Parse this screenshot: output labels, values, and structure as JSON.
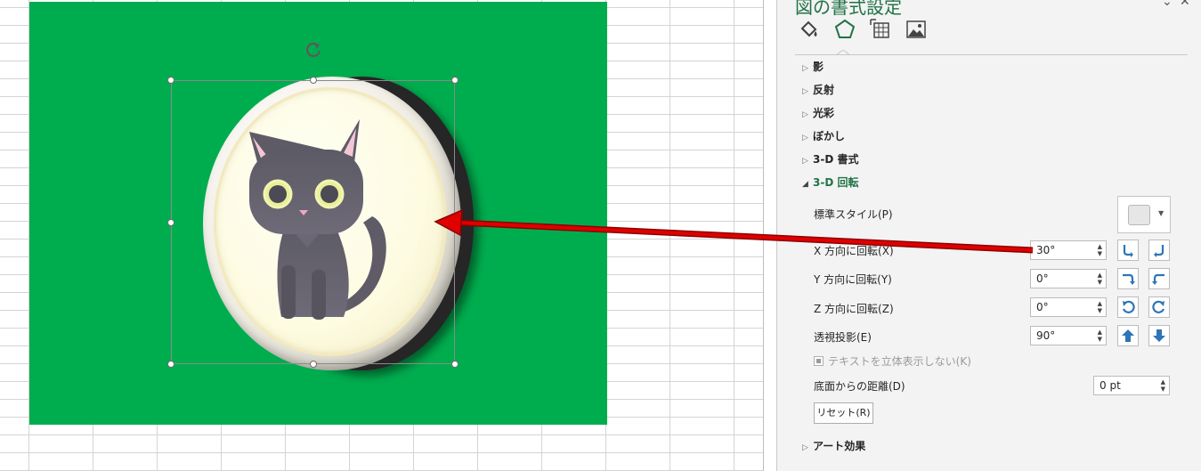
{
  "pane": {
    "title": "図の書式設定",
    "pin_glyph": "⌄",
    "close_glyph": "✕",
    "tabs": [
      {
        "name": "fill-line",
        "icon": "paint-bucket-icon"
      },
      {
        "name": "effects",
        "icon": "pentagon-icon"
      },
      {
        "name": "size-properties",
        "icon": "size-properties-icon"
      },
      {
        "name": "picture",
        "icon": "picture-icon"
      }
    ],
    "active_tab": "effects",
    "sections": {
      "shadow": "影",
      "reflection": "反射",
      "glow": "光彩",
      "soft_edges": "ぼかし",
      "format_3d": "3-D 書式",
      "rotation_3d": "3-D 回転",
      "artistic_effects": "アート効果"
    },
    "rotation": {
      "presets_label": "標準スタイル(P)",
      "x_label": "X 方向に回転(X)",
      "x_value": "30°",
      "y_label": "Y 方向に回転(Y)",
      "y_value": "0°",
      "z_label": "Z 方向に回転(Z)",
      "z_value": "0°",
      "perspective_label": "透視投影(E)",
      "perspective_value": "90°",
      "keep_text_flat_label": "テキストを立体表示しない(K)",
      "distance_label": "底面からの距離(D)",
      "distance_value": "0 pt",
      "reset_label": "リセット(R)"
    },
    "spin_up": "▲",
    "spin_down": "▼",
    "collapsed_glyph": "▷",
    "expanded_glyph": "◢",
    "caret_glyph": "▼"
  },
  "colors": {
    "picture_background": "#00ad4e",
    "accent": "#217346",
    "arrow": "#e00000",
    "rotate_button_icon": "#2e75b6"
  }
}
